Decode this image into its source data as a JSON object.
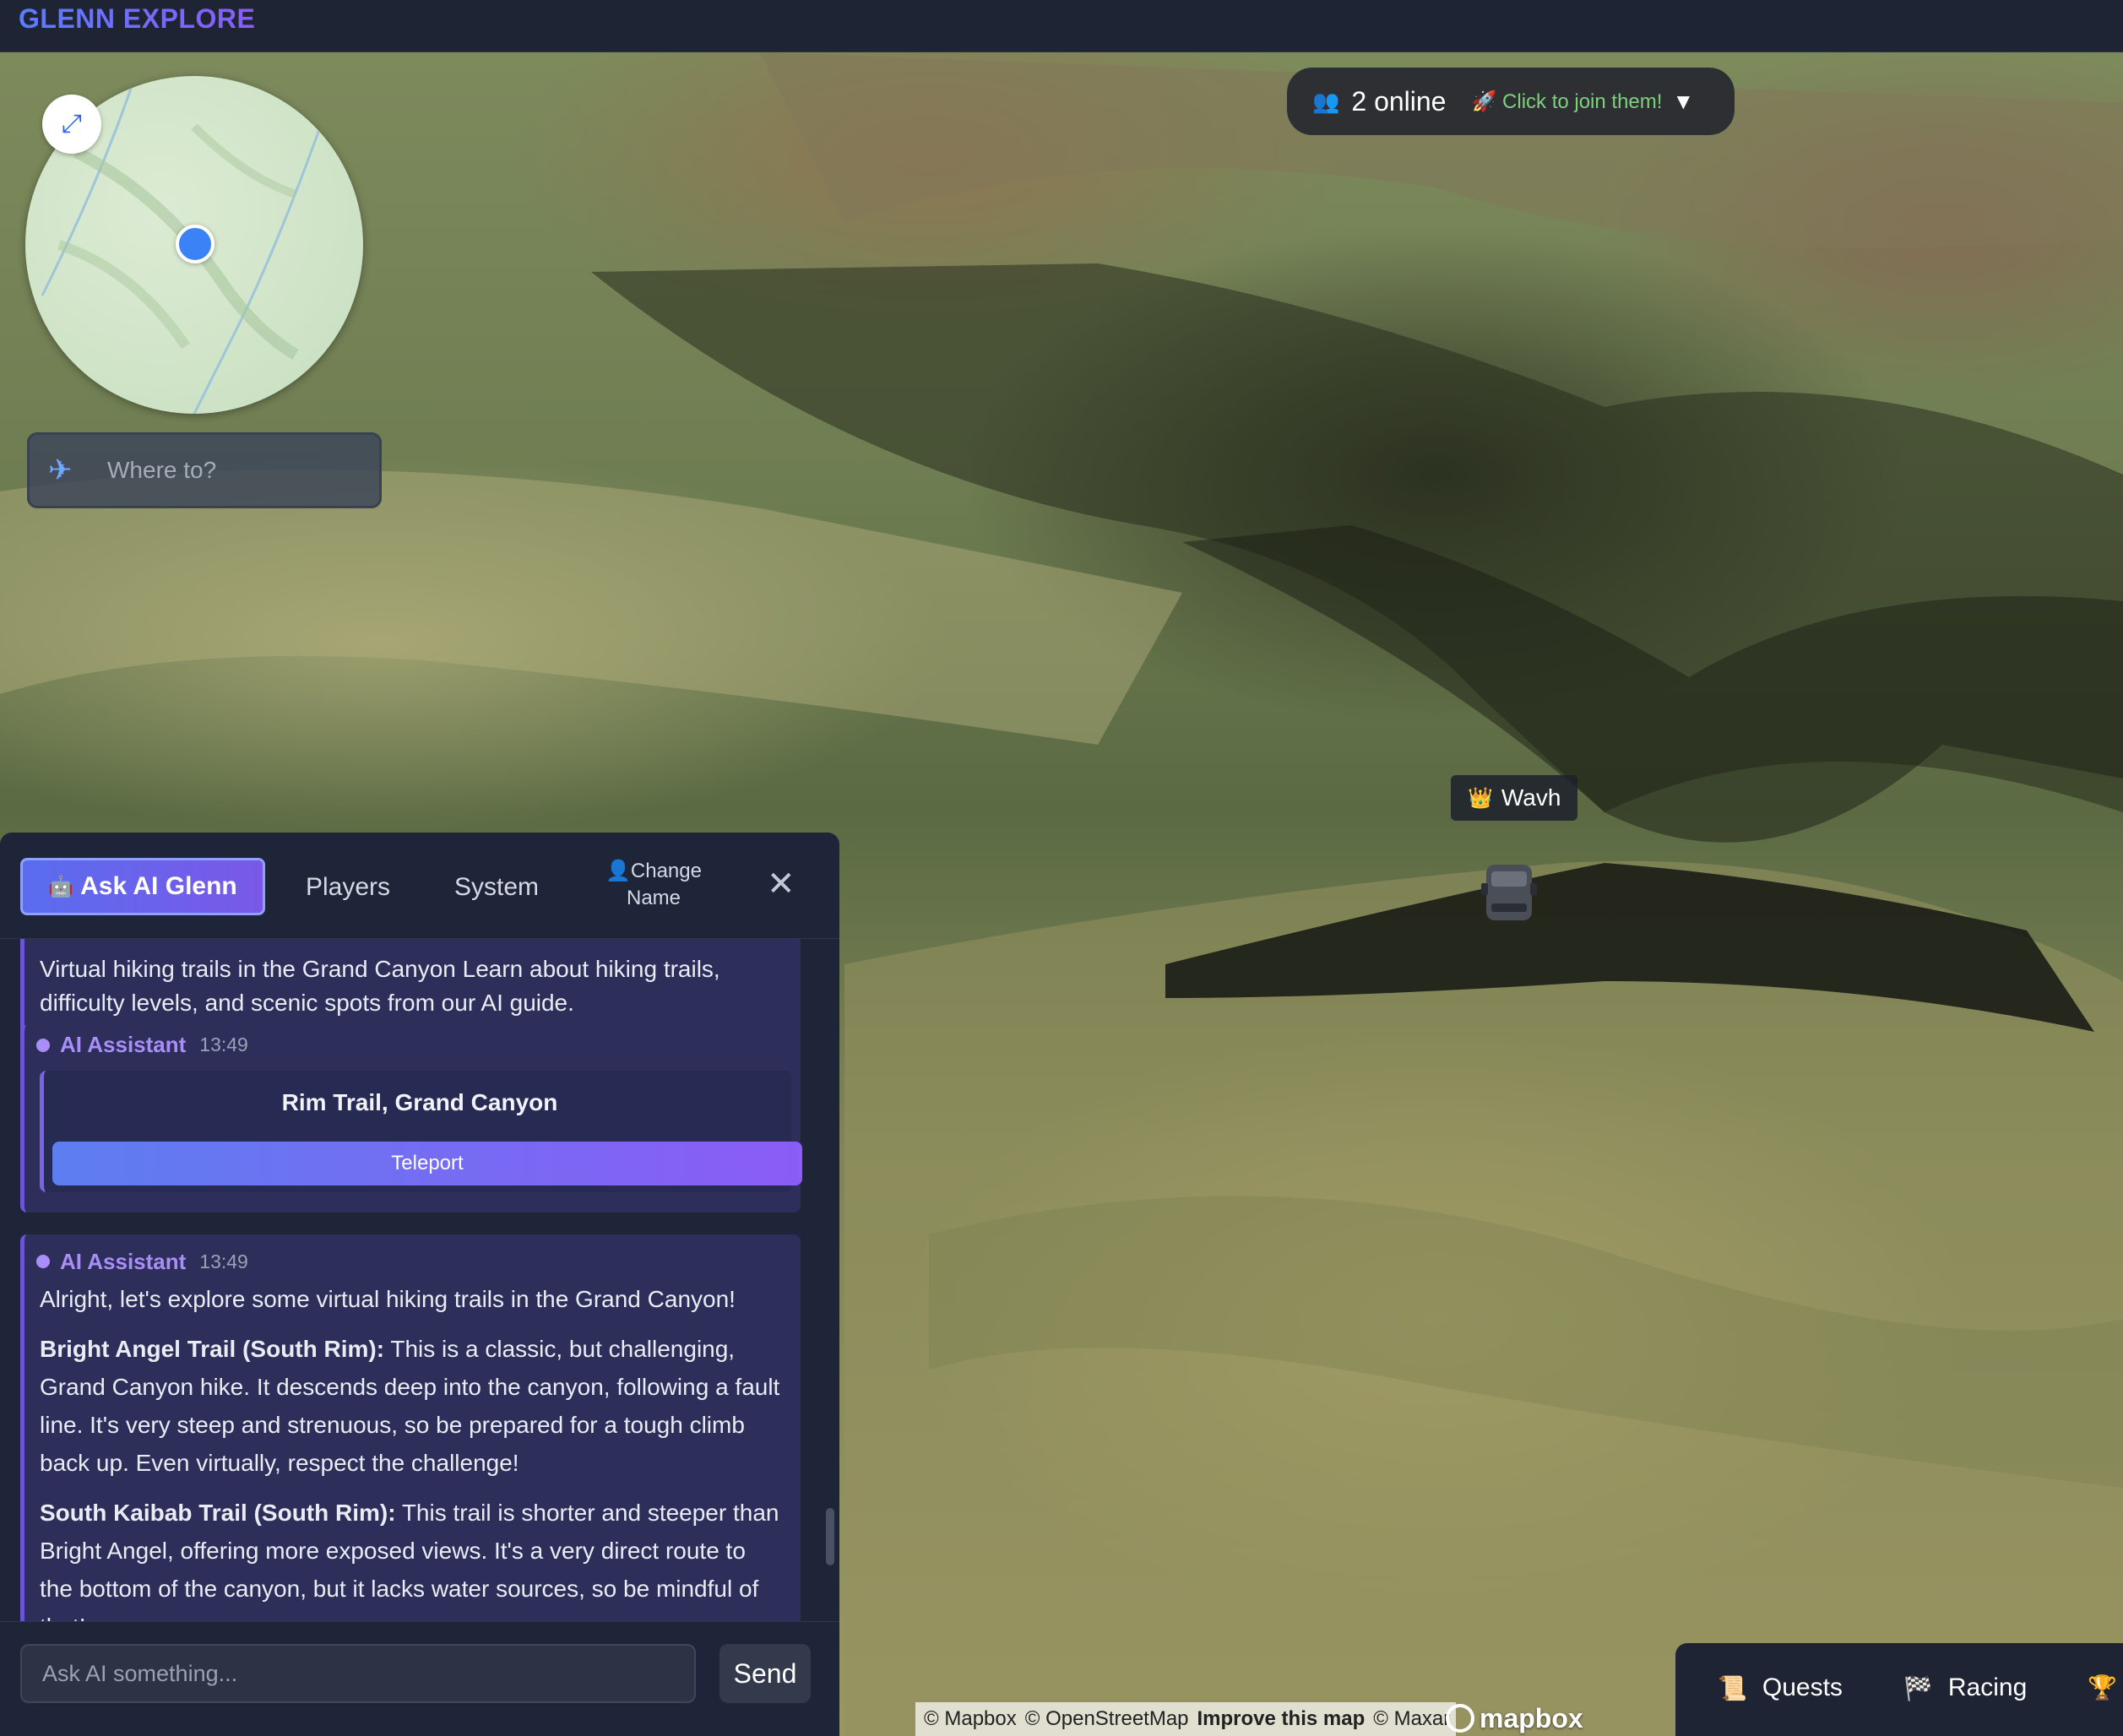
{
  "app": {
    "brand": "GLENN EXPLORE"
  },
  "minimap": {
    "expand_icon": "expand-arrows-icon"
  },
  "search": {
    "placeholder": "Where to?",
    "icon": "plane-icon"
  },
  "online": {
    "count_label": "2 online",
    "join_label": "Click to join them!",
    "caret": "▼"
  },
  "player": {
    "name": "Wavh",
    "crown_icon": "crown-icon"
  },
  "chat": {
    "tabs": {
      "ask": "Ask AI Glenn",
      "players": "Players",
      "system": "System",
      "change_name_line1": "Change",
      "change_name_line2": "Name",
      "close": "✕"
    },
    "messages": [
      {
        "text": "Virtual hiking trails in the Grand Canyon Learn about hiking trails, difficulty levels, and scenic spots from our AI guide."
      },
      {
        "sender": "AI Assistant",
        "time": "13:49",
        "location": "Rim Trail, Grand Canyon",
        "action": "Teleport"
      },
      {
        "sender": "AI Assistant",
        "time": "13:49",
        "intro": "Alright, let's explore some virtual hiking trails in the Grand Canyon!",
        "p1_title": "Bright Angel Trail (South Rim):",
        "p1_text": " This is a classic, but challenging, Grand Canyon hike. It descends deep into the canyon, following a fault line. It's very steep and strenuous, so be prepared for a tough climb back up. Even virtually, respect the challenge!",
        "p2_title": "South Kaibab Trail (South Rim):",
        "p2_text": " This trail is shorter and steeper than Bright Angel, offering more exposed views. It's a very direct route to the bottom of the canyon, but it lacks water sources, so be mindful of that!"
      }
    ],
    "composer": {
      "placeholder": "Ask AI something...",
      "send": "Send"
    }
  },
  "attribution": {
    "mapbox": "© Mapbox",
    "osm": "© OpenStreetMap",
    "improve": "Improve this map",
    "maxar": "© Maxar",
    "logo": "mapbox"
  },
  "bottom_menu": {
    "quests": "Quests",
    "racing": "Racing"
  }
}
